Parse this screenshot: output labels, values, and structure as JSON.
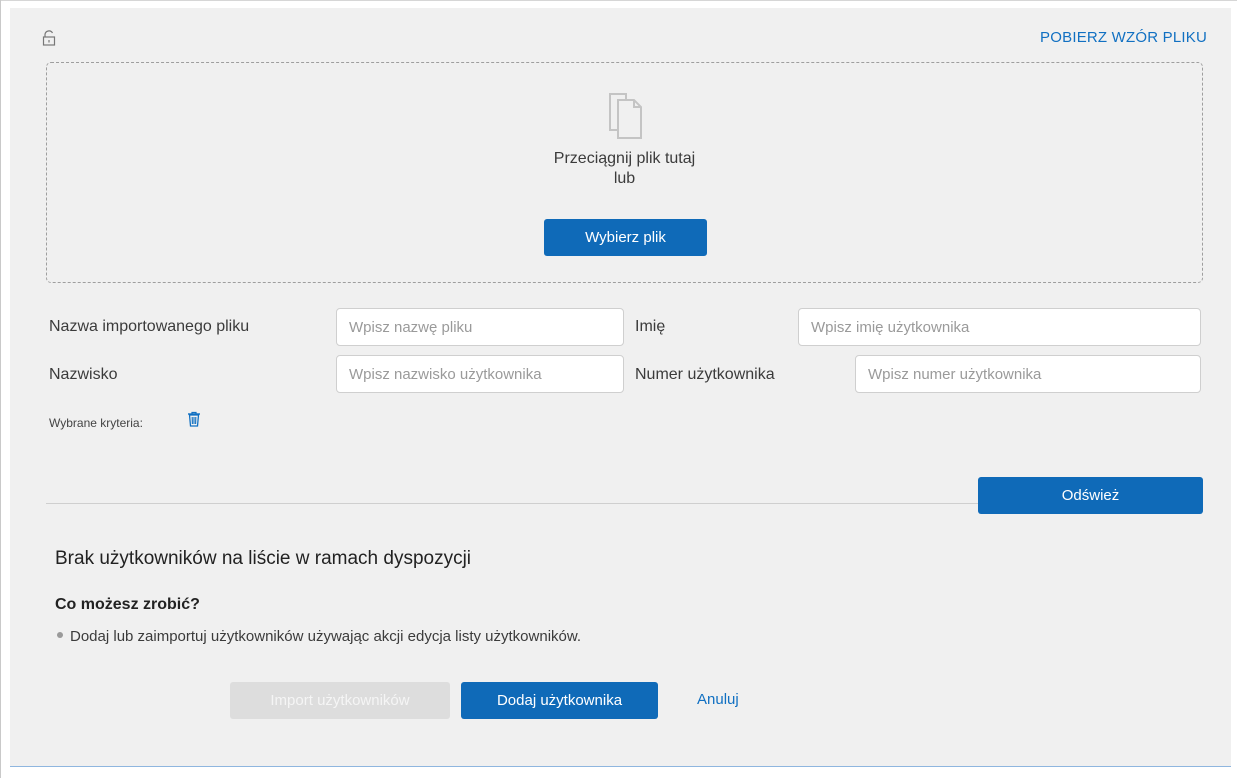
{
  "header": {
    "download_template_link": "POBIERZ WZÓR PLIKU"
  },
  "dropzone": {
    "drag_text": "Przeciągnij plik tutaj",
    "or_text": "lub",
    "choose_button": "Wybierz plik"
  },
  "filters": {
    "file_name_label": "Nazwa importowanego pliku",
    "file_name_placeholder": "Wpisz nazwę pliku",
    "first_name_label": "Imię",
    "first_name_placeholder": "Wpisz imię użytkownika",
    "last_name_label": "Nazwisko",
    "last_name_placeholder": "Wpisz nazwisko użytkownika",
    "user_number_label": "Numer użytkownika",
    "user_number_placeholder": "Wpisz numer użytkownika",
    "selected_criteria_label": "Wybrane kryteria:",
    "refresh_button": "Odśwież"
  },
  "empty_state": {
    "title": "Brak użytkowników na liście w ramach dyspozycji",
    "help_title": "Co możesz zrobić?",
    "help_items": [
      "Dodaj lub zaimportuj użytkowników używając akcji edycja listy użytkowników."
    ]
  },
  "actions": {
    "import_button": "Import użytkowników",
    "add_button": "Dodaj użytkownika",
    "cancel_link": "Anuluj"
  },
  "colors": {
    "primary": "#0f6ab8",
    "link": "#1170c2",
    "panel_bg": "#f0f0f0",
    "disabled_bg": "#dddddd"
  },
  "icons": {
    "lock": "lock-open-icon",
    "document": "document-copy-icon",
    "trash": "trash-icon"
  }
}
